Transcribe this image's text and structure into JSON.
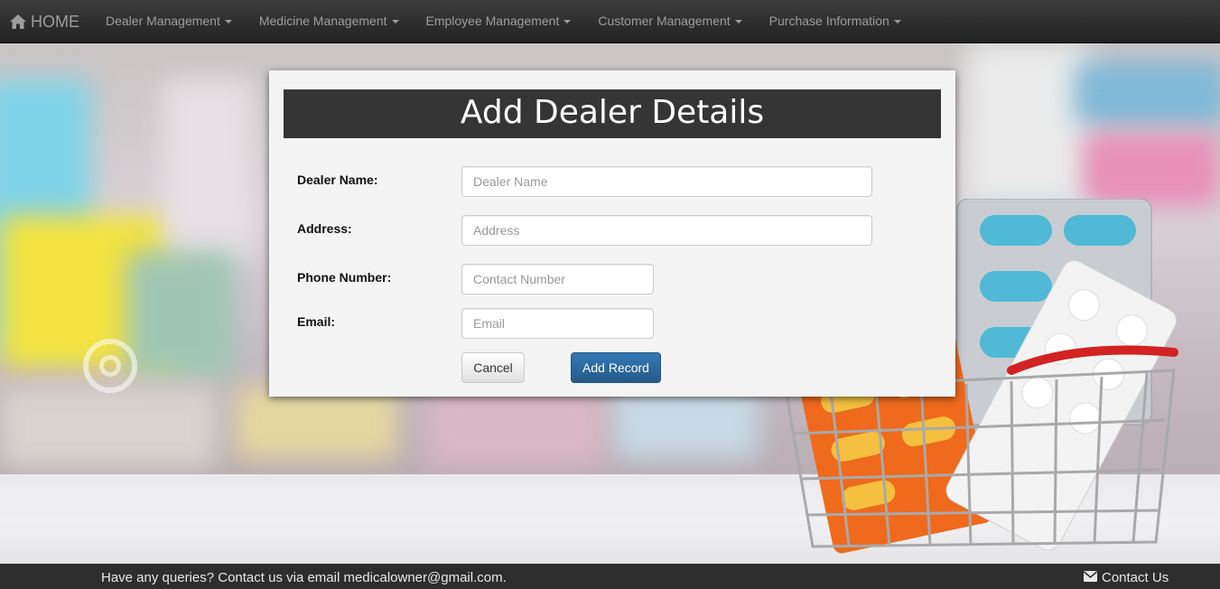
{
  "nav": {
    "home_label": "HOME",
    "items": [
      {
        "label": "Dealer Management"
      },
      {
        "label": "Medicine Management"
      },
      {
        "label": "Employee Management"
      },
      {
        "label": "Customer Management"
      },
      {
        "label": "Purchase Information"
      }
    ]
  },
  "form": {
    "title": "Add Dealer Details",
    "fields": {
      "dealer_name": {
        "label": "Dealer Name:",
        "placeholder": "Dealer Name",
        "value": ""
      },
      "address": {
        "label": "Address:",
        "placeholder": "Address",
        "value": ""
      },
      "phone": {
        "label": "Phone Number:",
        "placeholder": "Contact Number",
        "value": ""
      },
      "email": {
        "label": "Email:",
        "placeholder": "Email",
        "value": ""
      }
    },
    "cancel_label": "Cancel",
    "submit_label": "Add Record"
  },
  "footer": {
    "text": "Have any queries? Contact us via email medicalowner@gmail.com.",
    "contact_label": "Contact Us"
  },
  "icons": {
    "home": "home-icon",
    "caret": "caret-down-icon",
    "envelope": "envelope-icon"
  },
  "colors": {
    "navbar": "#222222",
    "panel_header": "#353535",
    "primary_button": "#337ab7",
    "footer": "#2d2d2d"
  }
}
